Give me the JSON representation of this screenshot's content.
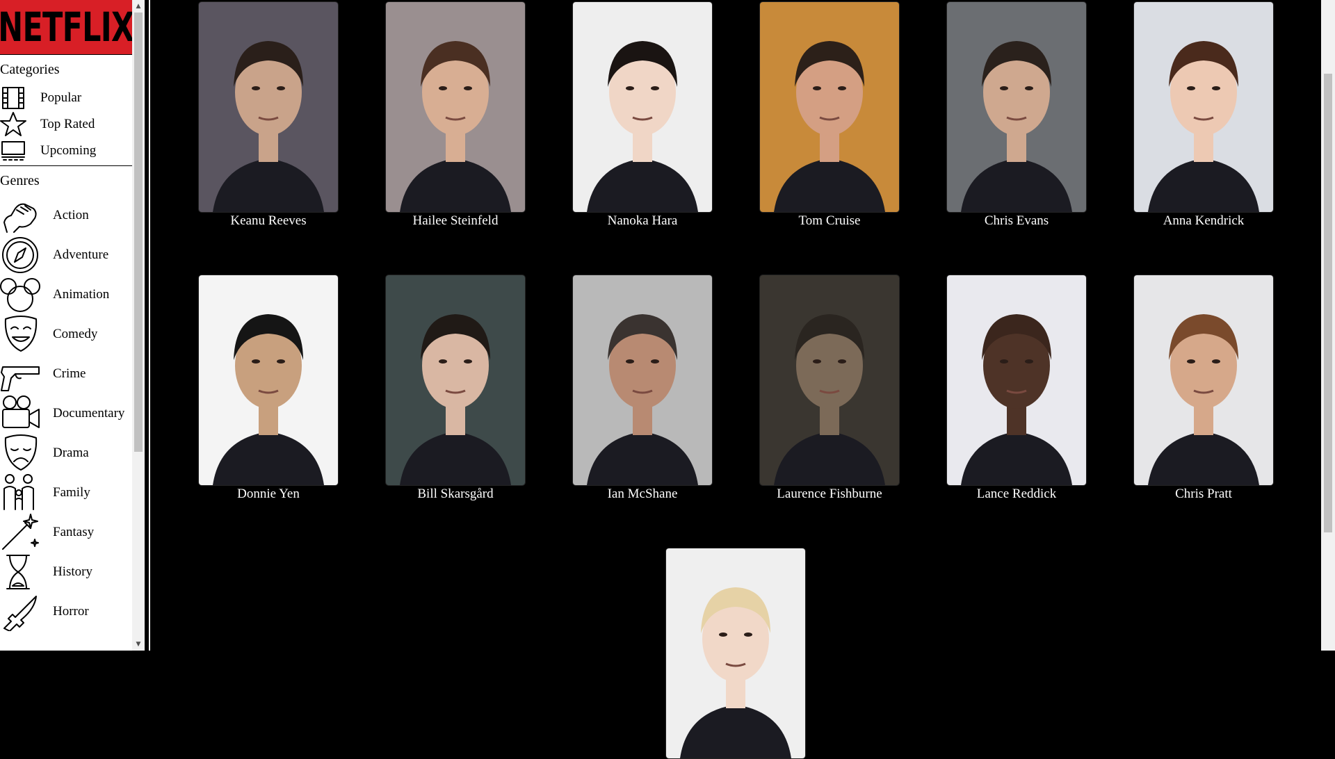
{
  "logo": {
    "text": "NETFLIX"
  },
  "sidebar": {
    "categories_title": "Categories",
    "categories": [
      {
        "label": "Popular",
        "icon": "film-icon"
      },
      {
        "label": "Top Rated",
        "icon": "star-icon"
      },
      {
        "label": "Upcoming",
        "icon": "cinema-icon"
      }
    ],
    "genres_title": "Genres",
    "genres": [
      {
        "label": "Action",
        "icon": "fist-icon"
      },
      {
        "label": "Adventure",
        "icon": "compass-icon"
      },
      {
        "label": "Animation",
        "icon": "mouse-ears-icon"
      },
      {
        "label": "Comedy",
        "icon": "comedy-mask-icon"
      },
      {
        "label": "Crime",
        "icon": "gun-icon"
      },
      {
        "label": "Documentary",
        "icon": "video-camera-icon"
      },
      {
        "label": "Drama",
        "icon": "drama-mask-icon"
      },
      {
        "label": "Family",
        "icon": "family-icon"
      },
      {
        "label": "Fantasy",
        "icon": "magic-wand-icon"
      },
      {
        "label": "History",
        "icon": "hourglass-icon"
      },
      {
        "label": "Horror",
        "icon": "knife-icon"
      }
    ]
  },
  "people": [
    {
      "name": "Keanu Reeves",
      "bg": "#5a5560",
      "skin": "#c9a38a",
      "hair": "#2a1f1a"
    },
    {
      "name": "Hailee Steinfeld",
      "bg": "#9a8f90",
      "skin": "#d8ae93",
      "hair": "#4a2f22"
    },
    {
      "name": "Nanoka Hara",
      "bg": "#eeeeee",
      "skin": "#f0d6c6",
      "hair": "#1a1412"
    },
    {
      "name": "Tom Cruise",
      "bg": "#c88a3a",
      "skin": "#d49f83",
      "hair": "#2c2019"
    },
    {
      "name": "Chris Evans",
      "bg": "#6b6e72",
      "skin": "#cfa88f",
      "hair": "#2a211c"
    },
    {
      "name": "Anna Kendrick",
      "bg": "#dadde3",
      "skin": "#edc9b3",
      "hair": "#4a2a1c"
    },
    {
      "name": "Donnie Yen",
      "bg": "#f4f4f4",
      "skin": "#c8a07e",
      "hair": "#151515"
    },
    {
      "name": "Bill Skarsgård",
      "bg": "#3e4a4a",
      "skin": "#d9b7a3",
      "hair": "#201a16"
    },
    {
      "name": "Ian McShane",
      "bg": "#b9b9b9",
      "skin": "#b88a72",
      "hair": "#3a3330"
    },
    {
      "name": "Laurence Fishburne",
      "bg": "#3a3630",
      "skin": "#7c6a58",
      "hair": "#2a2520"
    },
    {
      "name": "Lance Reddick",
      "bg": "#e9e9ee",
      "skin": "#4e3327",
      "hair": "#3b261d"
    },
    {
      "name": "Chris Pratt",
      "bg": "#e6e6e8",
      "skin": "#d6a88a",
      "hair": "#7a4a2c"
    },
    {
      "name": "",
      "bg": "#efefef",
      "skin": "#f1d8c8",
      "hair": "#e6d2a6"
    }
  ]
}
